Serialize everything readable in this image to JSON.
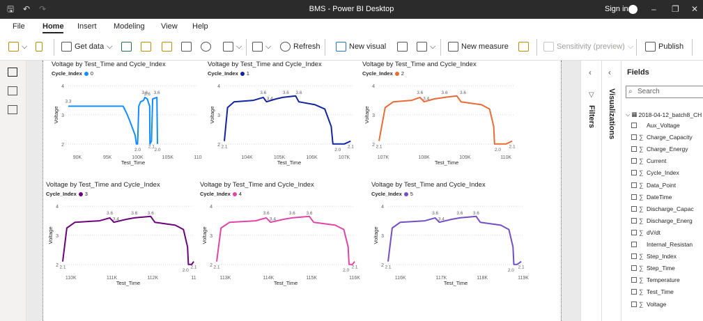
{
  "window": {
    "title": "BMS - Power BI Desktop",
    "sign_in": "Sign in",
    "quick_access": [
      "save-icon",
      "undo-icon",
      "redo-icon"
    ],
    "controls": [
      "minimize-icon",
      "restore-icon",
      "close-icon"
    ]
  },
  "menu": {
    "items": [
      "File",
      "Home",
      "Insert",
      "Modeling",
      "View",
      "Help"
    ],
    "active": "Home"
  },
  "ribbon": {
    "get_data": "Get data",
    "refresh": "Refresh",
    "new_visual": "New visual",
    "new_measure": "New measure",
    "sensitivity": "Sensitivity (preview)",
    "publish": "Publish"
  },
  "panes": {
    "filters": "Filters",
    "visualizations": "Visualizations",
    "fields": "Fields",
    "search_placeholder": "Search",
    "table_name": "2018-04-12_batch8_CH",
    "fields_list": [
      {
        "name": "Aux_Voltage",
        "sigma": false
      },
      {
        "name": "Charge_Capacity",
        "sigma": true
      },
      {
        "name": "Charge_Energy",
        "sigma": true
      },
      {
        "name": "Current",
        "sigma": true
      },
      {
        "name": "Cycle_Index",
        "sigma": true
      },
      {
        "name": "Data_Point",
        "sigma": true
      },
      {
        "name": "DateTime",
        "sigma": true
      },
      {
        "name": "Discharge_Capac",
        "sigma": true
      },
      {
        "name": "Discharge_Energ",
        "sigma": true
      },
      {
        "name": "dV/dt",
        "sigma": true
      },
      {
        "name": "Internal_Resistan",
        "sigma": false
      },
      {
        "name": "Step_Index",
        "sigma": true
      },
      {
        "name": "Step_Time",
        "sigma": true
      },
      {
        "name": "Temperature",
        "sigma": true
      },
      {
        "name": "Test_Time",
        "sigma": true
      },
      {
        "name": "Voltage",
        "sigma": true
      }
    ]
  },
  "chart_data": [
    {
      "type": "line",
      "title": "Voltage by Test_Time and Cycle_Index",
      "legend_title": "Cycle_Index",
      "series_name": "0",
      "color": "#118DFF",
      "xlabel": "Test_Time",
      "ylabel": "Voltage",
      "x_ticks": [
        "90K",
        "95K",
        "100K",
        "105K",
        "110"
      ],
      "x_tick_values": [
        90000,
        95000,
        100000,
        105000,
        110000
      ],
      "xlim": [
        88500,
        110000
      ],
      "y_ticks": [
        "4",
        "3",
        "2"
      ],
      "ylim": [
        1.9,
        4.1
      ],
      "points": [
        [
          88500,
          3.3
        ],
        [
          96500,
          3.3
        ],
        [
          97600,
          3.3
        ],
        [
          98200,
          3.05
        ],
        [
          98700,
          2.8
        ],
        [
          99600,
          2.3
        ],
        [
          99800,
          2.0
        ],
        [
          100000,
          2.0
        ],
        [
          100200,
          3.3
        ],
        [
          100500,
          3.45
        ],
        [
          101000,
          3.5
        ],
        [
          101200,
          3.6
        ],
        [
          101600,
          3.55
        ],
        [
          102000,
          3.3
        ],
        [
          102050,
          2.0
        ],
        [
          102300,
          2.1
        ],
        [
          102500,
          3.55
        ],
        [
          103200,
          3.6
        ],
        [
          103300,
          2.0
        ]
      ],
      "data_labels": [
        {
          "x": 88500,
          "y": 3.3,
          "text": "3.3"
        },
        {
          "x": 101200,
          "y": 3.6,
          "text": "3.6"
        },
        {
          "x": 101600,
          "y": 3.55,
          "text": "3.6"
        },
        {
          "x": 103200,
          "y": 3.6,
          "text": "3.6"
        },
        {
          "x": 100000,
          "y": 2.0,
          "text": "2.0"
        },
        {
          "x": 102300,
          "y": 2.1,
          "text": "2.1"
        },
        {
          "x": 103300,
          "y": 2.0,
          "text": "2.0"
        }
      ]
    },
    {
      "type": "line",
      "title": "Voltage by Test_Time and Cycle_Index",
      "legend_title": "Cycle_Index",
      "series_name": "1",
      "color": "#12239E",
      "xlabel": "Test_Time",
      "ylabel": "Voltage",
      "x_ticks": [
        "104K",
        "105K",
        "106K",
        "107K"
      ],
      "x_tick_values": [
        104000,
        105000,
        106000,
        107000
      ],
      "xlim": [
        103300,
        107300
      ],
      "y_ticks": [
        "4",
        "3",
        "2"
      ],
      "ylim": [
        1.9,
        4.1
      ],
      "points": [
        [
          103300,
          2.1
        ],
        [
          103400,
          3.25
        ],
        [
          103600,
          3.45
        ],
        [
          104200,
          3.5
        ],
        [
          104500,
          3.6
        ],
        [
          104600,
          3.45
        ],
        [
          104900,
          3.55
        ],
        [
          105100,
          3.6
        ],
        [
          105500,
          3.65
        ],
        [
          105600,
          3.45
        ],
        [
          106100,
          3.35
        ],
        [
          106400,
          3.2
        ],
        [
          106600,
          2.6
        ],
        [
          106650,
          2.0
        ],
        [
          107000,
          2.0
        ],
        [
          107200,
          2.1
        ]
      ],
      "data_labels": [
        {
          "x": 104500,
          "y": 3.6,
          "text": "3.6"
        },
        {
          "x": 104700,
          "y": 3.4,
          "text": "3.4"
        },
        {
          "x": 105200,
          "y": 3.6,
          "text": "3.6"
        },
        {
          "x": 105600,
          "y": 3.6,
          "text": "3.6"
        },
        {
          "x": 103300,
          "y": 2.1,
          "text": "2.1"
        },
        {
          "x": 106800,
          "y": 2.0,
          "text": "2.0"
        },
        {
          "x": 107200,
          "y": 2.1,
          "text": "2.1"
        }
      ]
    },
    {
      "type": "line",
      "title": "Voltage by Test_Time and Cycle_Index",
      "legend_title": "Cycle_Index",
      "series_name": "2",
      "color": "#E66C37",
      "xlabel": "Test_Time",
      "ylabel": "Voltage",
      "x_ticks": [
        "107K",
        "108K",
        "109K",
        "110K"
      ],
      "x_tick_values": [
        107000,
        108000,
        109000,
        110000
      ],
      "xlim": [
        106900,
        110200
      ],
      "y_ticks": [
        "4",
        "3",
        "2"
      ],
      "ylim": [
        1.9,
        4.1
      ],
      "points": [
        [
          106900,
          2.1
        ],
        [
          107050,
          3.25
        ],
        [
          107250,
          3.45
        ],
        [
          107700,
          3.5
        ],
        [
          107900,
          3.6
        ],
        [
          108000,
          3.45
        ],
        [
          108250,
          3.55
        ],
        [
          108500,
          3.6
        ],
        [
          108800,
          3.65
        ],
        [
          108900,
          3.45
        ],
        [
          109400,
          3.35
        ],
        [
          109600,
          3.2
        ],
        [
          109700,
          2.6
        ],
        [
          109720,
          2.0
        ],
        [
          110000,
          2.0
        ],
        [
          110150,
          2.1
        ]
      ],
      "data_labels": [
        {
          "x": 107900,
          "y": 3.6,
          "text": "3.6"
        },
        {
          "x": 108050,
          "y": 3.4,
          "text": "3.4"
        },
        {
          "x": 108500,
          "y": 3.6,
          "text": "3.6"
        },
        {
          "x": 108950,
          "y": 3.6,
          "text": "3.6"
        },
        {
          "x": 106900,
          "y": 2.1,
          "text": "2.1"
        },
        {
          "x": 109800,
          "y": 2.0,
          "text": "2.0"
        },
        {
          "x": 110150,
          "y": 2.1,
          "text": "2.1"
        }
      ]
    },
    {
      "type": "line",
      "title": "Voltage by Test_Time and Cycle_Index",
      "legend_title": "Cycle_Index",
      "series_name": "3",
      "color": "#6B007B",
      "xlabel": "Test_Time",
      "ylabel": "Voltage",
      "x_ticks": [
        "110K",
        "111K",
        "112K",
        "11"
      ],
      "x_tick_values": [
        110000,
        111000,
        112000,
        113000
      ],
      "xlim": [
        109800,
        113000
      ],
      "y_ticks": [
        "4",
        "3",
        "2"
      ],
      "ylim": [
        1.9,
        4.1
      ],
      "points": [
        [
          109800,
          2.1
        ],
        [
          109900,
          3.25
        ],
        [
          110100,
          3.45
        ],
        [
          110700,
          3.5
        ],
        [
          110950,
          3.6
        ],
        [
          111050,
          3.45
        ],
        [
          111350,
          3.55
        ],
        [
          111550,
          3.6
        ],
        [
          111950,
          3.65
        ],
        [
          112050,
          3.45
        ],
        [
          112550,
          3.35
        ],
        [
          112750,
          3.2
        ],
        [
          112850,
          2.6
        ],
        [
          112870,
          2.0
        ],
        [
          112950,
          2.0
        ],
        [
          113000,
          2.1
        ]
      ],
      "data_labels": [
        {
          "x": 110950,
          "y": 3.6,
          "text": "3.6"
        },
        {
          "x": 111100,
          "y": 3.4,
          "text": "3.4"
        },
        {
          "x": 111550,
          "y": 3.6,
          "text": "3.6"
        },
        {
          "x": 111950,
          "y": 3.6,
          "text": "3.6"
        },
        {
          "x": 109800,
          "y": 2.1,
          "text": "2.1"
        },
        {
          "x": 112800,
          "y": 2.0,
          "text": "2.0"
        },
        {
          "x": 113000,
          "y": 2.1,
          "text": "2.1"
        }
      ]
    },
    {
      "type": "line",
      "title": "Voltage by Test_Time and Cycle_Index",
      "legend_title": "Cycle_Index",
      "series_name": "4",
      "color": "#E044A7",
      "xlabel": "Test_Time",
      "ylabel": "Voltage",
      "x_ticks": [
        "113K",
        "114K",
        "115K",
        "116K"
      ],
      "x_tick_values": [
        113000,
        114000,
        115000,
        116000
      ],
      "xlim": [
        112800,
        116000
      ],
      "y_ticks": [
        "4",
        "3",
        "2"
      ],
      "ylim": [
        1.9,
        4.1
      ],
      "points": [
        [
          112800,
          2.1
        ],
        [
          112900,
          3.25
        ],
        [
          113100,
          3.45
        ],
        [
          113700,
          3.5
        ],
        [
          113950,
          3.6
        ],
        [
          114050,
          3.45
        ],
        [
          114350,
          3.55
        ],
        [
          114550,
          3.6
        ],
        [
          114950,
          3.65
        ],
        [
          115050,
          3.45
        ],
        [
          115550,
          3.35
        ],
        [
          115750,
          3.2
        ],
        [
          115850,
          2.6
        ],
        [
          115870,
          2.0
        ],
        [
          115950,
          2.0
        ],
        [
          116000,
          2.1
        ]
      ],
      "data_labels": [
        {
          "x": 113950,
          "y": 3.6,
          "text": "3.6"
        },
        {
          "x": 114100,
          "y": 3.4,
          "text": "3.4"
        },
        {
          "x": 114550,
          "y": 3.6,
          "text": "3.6"
        },
        {
          "x": 114950,
          "y": 3.6,
          "text": "3.6"
        },
        {
          "x": 112800,
          "y": 2.1,
          "text": "2.1"
        },
        {
          "x": 115800,
          "y": 2.0,
          "text": "2.0"
        },
        {
          "x": 116000,
          "y": 2.1,
          "text": "2.1"
        }
      ]
    },
    {
      "type": "line",
      "title": "Voltage by Test_Time and Cycle_Index",
      "legend_title": "Cycle_Index",
      "series_name": "5",
      "color": "#744EC2",
      "xlabel": "Test_Time",
      "ylabel": "Voltage",
      "x_ticks": [
        "116K",
        "117K",
        "118K",
        "119K"
      ],
      "x_tick_values": [
        116000,
        117000,
        118000,
        119000
      ],
      "xlim": [
        115700,
        119000
      ],
      "y_ticks": [
        "4",
        "3",
        "2"
      ],
      "ylim": [
        1.9,
        4.1
      ],
      "points": [
        [
          115700,
          2.1
        ],
        [
          115800,
          3.25
        ],
        [
          116000,
          3.45
        ],
        [
          116600,
          3.5
        ],
        [
          116850,
          3.6
        ],
        [
          116950,
          3.45
        ],
        [
          117250,
          3.55
        ],
        [
          117450,
          3.6
        ],
        [
          117850,
          3.65
        ],
        [
          117950,
          3.45
        ],
        [
          118450,
          3.35
        ],
        [
          118650,
          3.2
        ],
        [
          118750,
          2.6
        ],
        [
          118770,
          2.0
        ],
        [
          118850,
          2.0
        ],
        [
          118950,
          2.1
        ]
      ],
      "data_labels": [
        {
          "x": 116850,
          "y": 3.6,
          "text": "3.6"
        },
        {
          "x": 117000,
          "y": 3.4,
          "text": "3.4"
        },
        {
          "x": 117450,
          "y": 3.6,
          "text": "3.6"
        },
        {
          "x": 117850,
          "y": 3.6,
          "text": "3.6"
        },
        {
          "x": 115700,
          "y": 2.1,
          "text": "2.1"
        },
        {
          "x": 118700,
          "y": 2.0,
          "text": "2.0"
        },
        {
          "x": 118950,
          "y": 2.1,
          "text": "2.1"
        }
      ]
    }
  ]
}
